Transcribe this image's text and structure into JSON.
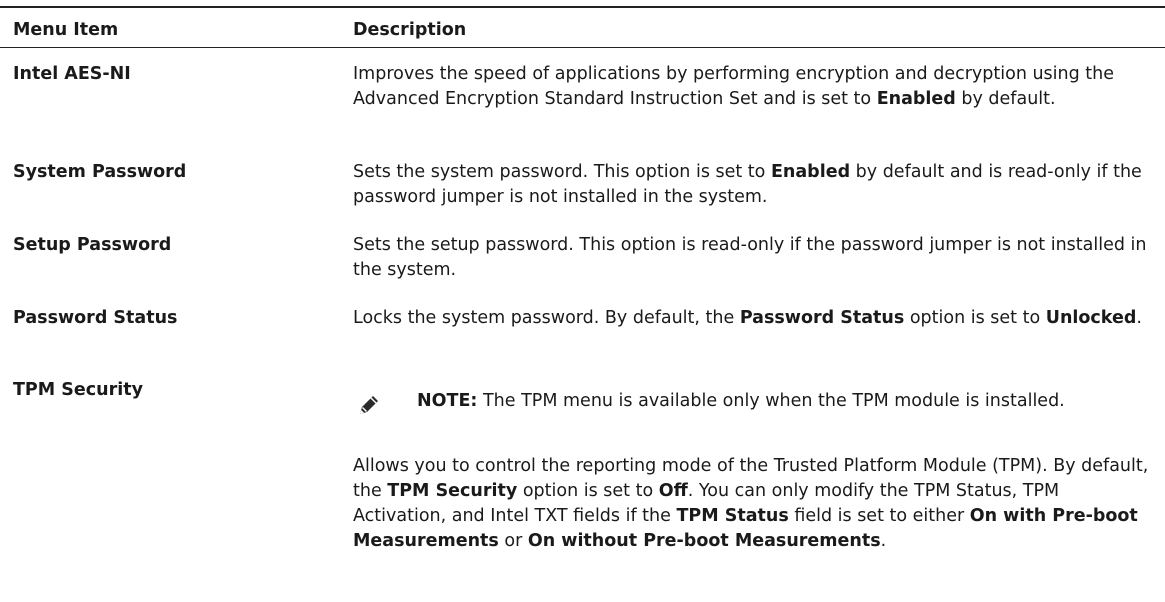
{
  "table": {
    "headers": {
      "menu_item": "Menu Item",
      "description": "Description"
    },
    "rows": [
      {
        "item": "Intel AES-NI",
        "desc": [
          {
            "t": "Improves the speed of applications by performing encryption and decryption using the Advanced Encryption Standard Instruction Set and is set to "
          },
          {
            "t": "Enabled",
            "b": true
          },
          {
            "t": " by default."
          }
        ]
      },
      {
        "item": "System Password",
        "desc": [
          {
            "t": "Sets the system password. This option is set to "
          },
          {
            "t": "Enabled",
            "b": true
          },
          {
            "t": " by default and is read-only if the password jumper is not installed in the system."
          }
        ]
      },
      {
        "item": "Setup Password",
        "desc": [
          {
            "t": "Sets the setup password. This option is read-only if the password jumper is not installed in the system."
          }
        ]
      },
      {
        "item": "Password Status",
        "desc": [
          {
            "t": "Locks the system password. By default, the "
          },
          {
            "t": "Password Status",
            "b": true
          },
          {
            "t": " option is set to "
          },
          {
            "t": "Unlocked",
            "b": true
          },
          {
            "t": "."
          }
        ]
      },
      {
        "item": "TPM Security",
        "note": {
          "icon": "pencil-icon",
          "label": "NOTE:",
          "text": " The TPM menu is available only when the TPM module is installed."
        },
        "desc": [
          {
            "t": "Allows you to control the reporting mode of the Trusted Platform Module (TPM). By default, the "
          },
          {
            "t": "TPM Security",
            "b": true
          },
          {
            "t": " option is set to "
          },
          {
            "t": "Off",
            "b": true
          },
          {
            "t": ". You can only modify the TPM Status, TPM Activation, and Intel TXT fields if the "
          },
          {
            "t": "TPM Status",
            "b": true
          },
          {
            "t": " field is set to either "
          },
          {
            "t": "On with Pre-boot Measurements",
            "b": true
          },
          {
            "t": " or "
          },
          {
            "t": "On without Pre-boot Measurements",
            "b": true
          },
          {
            "t": "."
          }
        ]
      }
    ]
  }
}
